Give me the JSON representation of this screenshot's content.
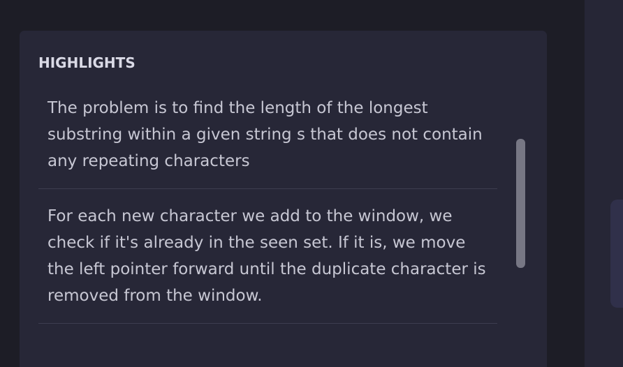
{
  "highlights": {
    "heading": "HIGHLIGHTS",
    "items": [
      {
        "text": "The problem is to find the length of the longest substring within a given string s that does not contain any repeating characters"
      },
      {
        "text": "For each new character we add to the window, we check if it's already in the seen set. If it is, we move the left pointer forward until the duplicate character is removed from the window."
      }
    ]
  }
}
